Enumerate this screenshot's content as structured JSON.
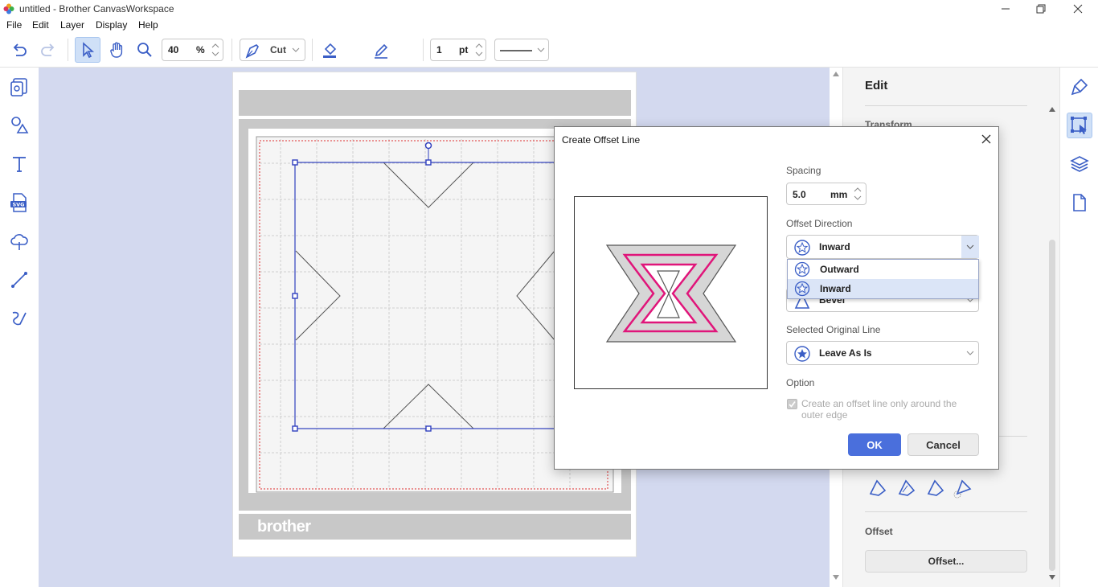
{
  "window": {
    "title": "untitled - Brother CanvasWorkspace"
  },
  "menu": [
    "File",
    "Edit",
    "Layer",
    "Display",
    "Help"
  ],
  "toolbar": {
    "zoom_value": "40",
    "zoom_unit": "%",
    "mode_label": "Cut",
    "line_width_value": "1",
    "line_width_unit": "pt",
    "fill_color": "#000000"
  },
  "canvas": {
    "watermark": "brother"
  },
  "right_panel": {
    "heading": "Edit",
    "transform_label": "Transform",
    "offset_label": "Offset",
    "offset_button": "Offset..."
  },
  "dialog": {
    "title": "Create Offset Line",
    "spacing_label": "Spacing",
    "spacing_value": "5.0",
    "spacing_unit": "mm",
    "direction_label": "Offset Direction",
    "direction_value": "Inward",
    "direction_options": [
      "Outward",
      "Inward"
    ],
    "corner_value": "Bevel",
    "original_label": "Selected Original Line",
    "original_value": "Leave As Is",
    "option_label": "Option",
    "option_checkbox": "Create an offset line only around the outer edge",
    "option_checkbox_line1": "Create an offset line only around the",
    "option_checkbox_line2": "outer edge",
    "ok_label": "OK",
    "cancel_label": "Cancel"
  },
  "colors": {
    "canvas_bg": "#d3d9ef",
    "selection": "#2f3fbf",
    "accent": "#4a6fdc",
    "offset_line": "#e0157a",
    "arrow": "#ee1111"
  }
}
